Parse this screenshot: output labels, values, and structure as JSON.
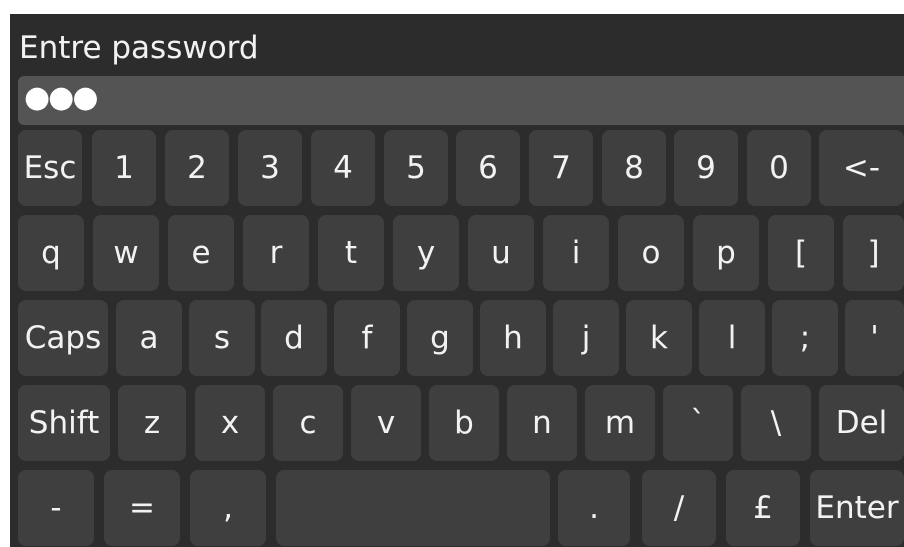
{
  "dialog": {
    "title": "Entre password",
    "password_display": "●●●"
  },
  "keyboard": {
    "row1": [
      "Esc",
      "1",
      "2",
      "3",
      "4",
      "5",
      "6",
      "7",
      "8",
      "9",
      "0",
      "<-"
    ],
    "row2": [
      "q",
      "w",
      "e",
      "r",
      "t",
      "y",
      "u",
      "i",
      "o",
      "p",
      "[",
      "]"
    ],
    "row3": [
      "Caps",
      "a",
      "s",
      "d",
      "f",
      "g",
      "h",
      "j",
      "k",
      "l",
      ";",
      "'"
    ],
    "row4": [
      "Shift",
      "z",
      "x",
      "c",
      "v",
      "b",
      "n",
      "m",
      "`",
      "\\",
      "Del"
    ],
    "row5": [
      "-",
      "=",
      ",",
      "",
      ".",
      "/",
      "£",
      "Enter"
    ]
  },
  "colors": {
    "panel_bg": "#2c2c2c",
    "key_bg": "#3f3f3f",
    "field_bg": "#545454",
    "text": "#f2f2f2"
  }
}
